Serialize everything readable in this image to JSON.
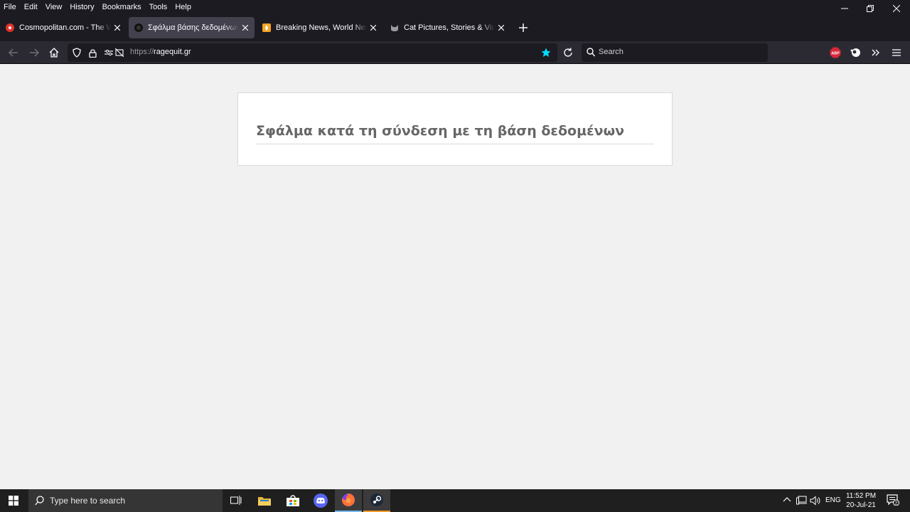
{
  "menu": [
    "File",
    "Edit",
    "View",
    "History",
    "Bookmarks",
    "Tools",
    "Help"
  ],
  "tabs": [
    {
      "title": "Cosmopolitan.com - The Women's",
      "favicon_color": "#e4322b",
      "active": false
    },
    {
      "title": "Σφάλμα βάσης δεδομένων",
      "favicon_color": "#111111",
      "active": true
    },
    {
      "title": "Breaking News, World News and",
      "favicon_color": "#f5a623",
      "active": false
    },
    {
      "title": "Cat Pictures, Stories & Videos. Cat",
      "favicon_color": "#9a9aa0",
      "active": false
    }
  ],
  "urlbar": {
    "scheme": "https://",
    "host": "ragequit.gr"
  },
  "search": {
    "placeholder": "Search"
  },
  "extensions": {
    "abp_label": "ABP"
  },
  "page": {
    "error_heading": "Σφάλμα κατά τη σύνδεση με τη βάση δεδομένων"
  },
  "taskbar": {
    "search_placeholder": "Type here to search",
    "language": "ENG",
    "time": "11:52 PM",
    "date": "20-Jul-21",
    "notification_count": "2"
  },
  "colors": {
    "accent_star": "#00ddff",
    "firefox_dark": "#1c1b22",
    "toolbar": "#2b2a33"
  }
}
